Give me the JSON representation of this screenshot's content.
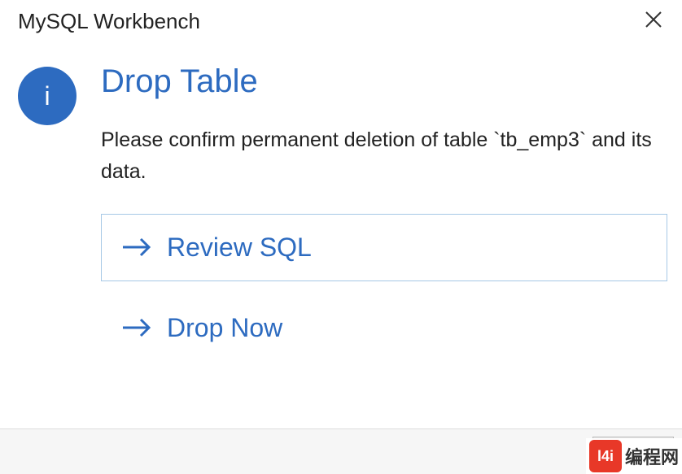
{
  "titlebar": {
    "title": "MySQL Workbench"
  },
  "icon": {
    "glyph": "i"
  },
  "dialog": {
    "heading": "Drop Table",
    "message": "Please confirm permanent deletion of table `tb_emp3` and its data."
  },
  "options": {
    "review_sql": "Review SQL",
    "drop_now": "Drop Now"
  },
  "watermark": {
    "badge": "l4i",
    "text": "编程网"
  }
}
